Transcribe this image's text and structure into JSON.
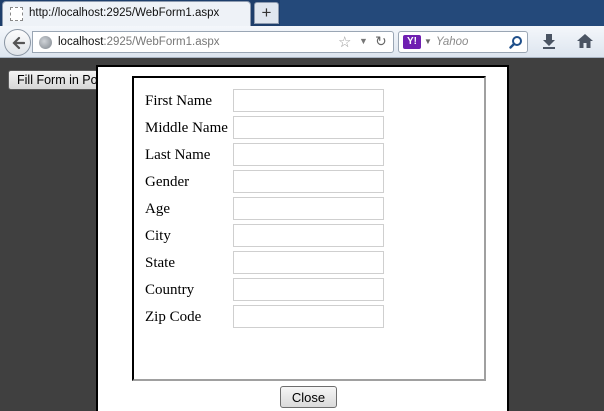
{
  "browser": {
    "tab_title": "http://localhost:2925/WebForm1.aspx",
    "new_tab_label": "+",
    "url_host": "localhost",
    "url_rest": ":2925/WebForm1.aspx",
    "search_placeholder": "Yahoo",
    "search_engine_logo": "Y!",
    "icons": [
      "page-icon",
      "back-arrow-icon",
      "globe-icon",
      "bookmark-star-icon",
      "dropdown-arrow-icon",
      "reload-icon",
      "yahoo-logo-icon",
      "search-icon",
      "download-icon",
      "home-icon"
    ]
  },
  "page": {
    "open_button_label": "Fill Form in Popup"
  },
  "form": {
    "fields": [
      {
        "label": "First Name",
        "value": ""
      },
      {
        "label": "Middle Name",
        "value": ""
      },
      {
        "label": "Last Name",
        "value": ""
      },
      {
        "label": "Gender",
        "value": ""
      },
      {
        "label": "Age",
        "value": ""
      },
      {
        "label": "City",
        "value": ""
      },
      {
        "label": "State",
        "value": ""
      },
      {
        "label": "Country",
        "value": ""
      },
      {
        "label": "Zip Code",
        "value": ""
      }
    ],
    "close_label": "Close"
  },
  "colors": {
    "overlay": "#404040",
    "tabstrip": "#1d3e6b",
    "yahoo_purple": "#6f1fb1"
  }
}
